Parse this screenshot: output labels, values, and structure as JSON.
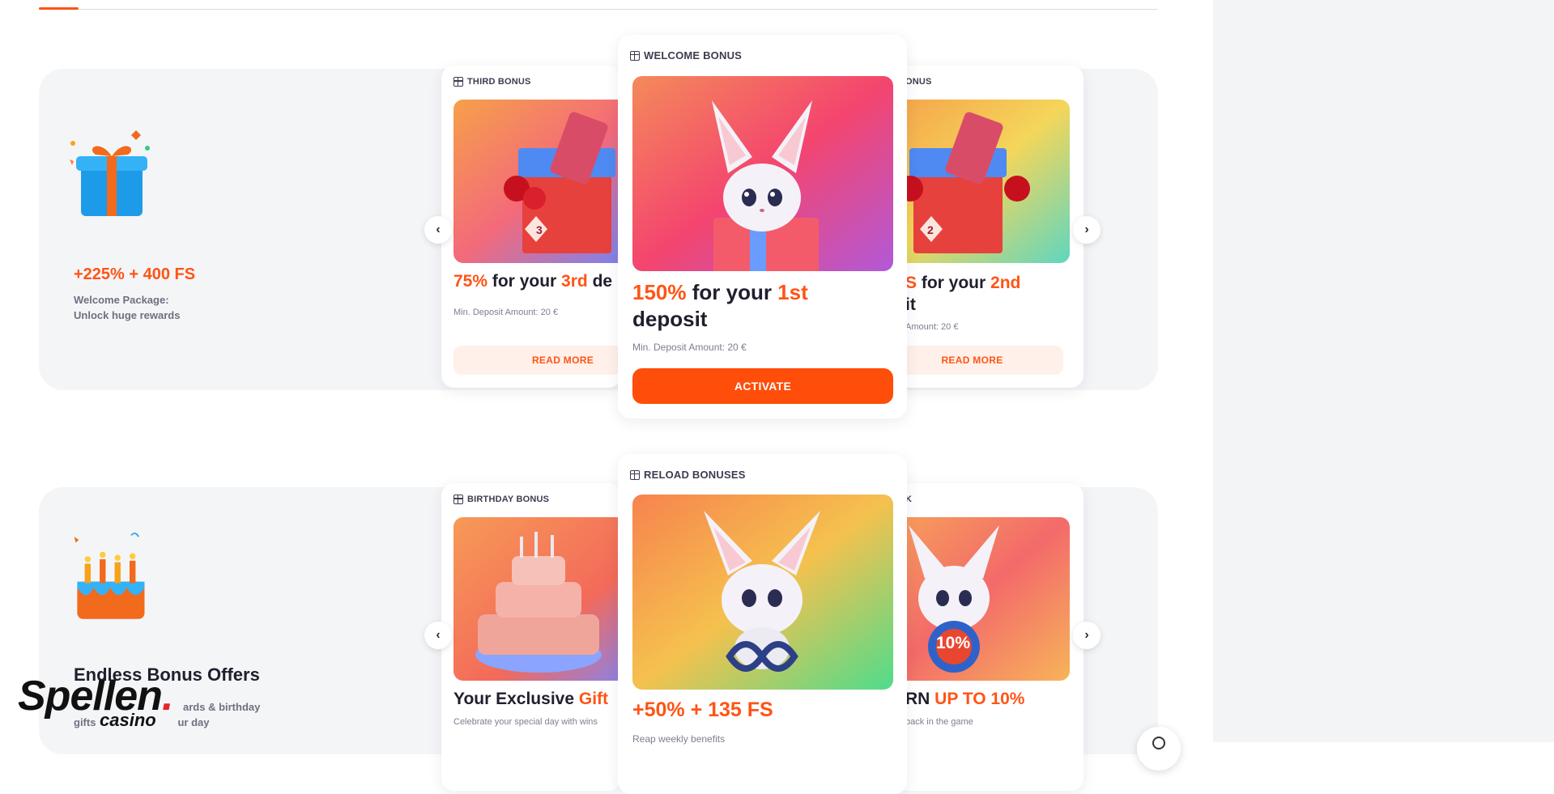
{
  "colors": {
    "accent": "#ff5416",
    "section_bg": "#f4f5f7",
    "soft_button_bg": "#fff0e9"
  },
  "section1": {
    "hero": {
      "title": "+225% + 400 FS",
      "desc_line1": "Welcome Package:",
      "desc_line2": "Unlock huge rewards"
    },
    "cards": {
      "left": {
        "tag": "THIRD BONUS",
        "title_hl1": "75%",
        "title_mid": " for your ",
        "title_hl2": "3rd",
        "title_tail": " de",
        "sub": "Min. Deposit Amount: 20 €",
        "button": "READ MORE"
      },
      "center": {
        "tag": "WELCOME BONUS",
        "title_hl1": "150%",
        "title_mid": " for your ",
        "title_hl2": "1st",
        "title_line2": "deposit",
        "sub": "Min. Deposit Amount: 20 €",
        "button": "ACTIVATE"
      },
      "right": {
        "tag": "ONUS",
        "title_hl1": "S",
        "title_mid": " for your ",
        "title_hl2": "2nd",
        "title_line2": "it",
        "sub": "Amount: 20 €",
        "button": "READ MORE"
      }
    }
  },
  "section2": {
    "hero": {
      "title": "Endless Bonus Offers",
      "desc_line1": "ards & birthday",
      "desc_line2": "gifts",
      "desc_line3": "ur day"
    },
    "cards": {
      "left": {
        "tag": "BIRTHDAY BONUS",
        "title_main": "Your Exclusive ",
        "title_hl": "Gift",
        "sub": "Celebrate your special day with wins"
      },
      "center": {
        "tag": "RELOAD BONUSES",
        "title": "+50% + 135 FS",
        "sub": "Reap weekly benefits"
      },
      "right": {
        "tag": "K",
        "title_main": "RN ",
        "title_hl": "UP TO 10%",
        "sub": "back in the game",
        "badge": "10%"
      }
    }
  },
  "logo": {
    "word": "Spellen",
    "sub": "casino",
    "dot": "."
  },
  "arrows": {
    "prev": "‹",
    "next": "›"
  }
}
